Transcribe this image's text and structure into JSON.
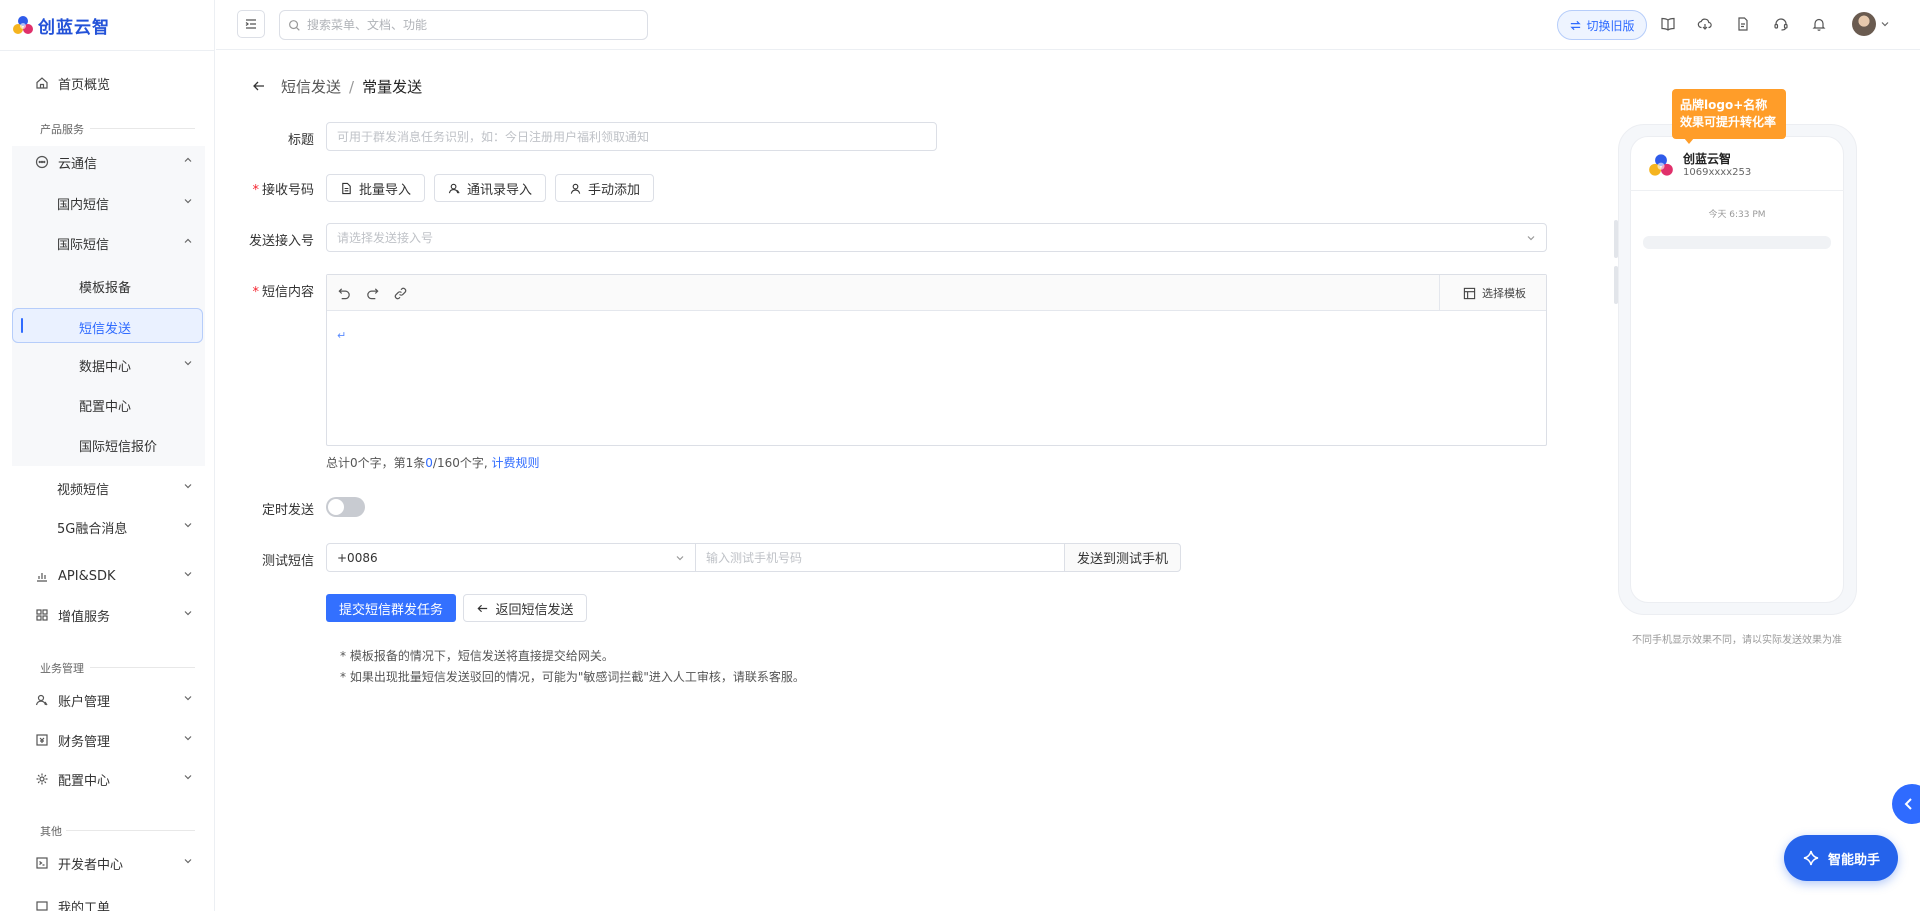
{
  "brand": {
    "name": "创蓝云智"
  },
  "search": {
    "placeholder": "搜索菜单、文档、功能"
  },
  "topbar": {
    "switch_label": "切换旧版"
  },
  "sidebar": {
    "home": "首页概览",
    "group_product": "产品服务",
    "cloud_comm": "云通信",
    "domestic_sms": "国内短信",
    "intl_sms": "国际短信",
    "template_filing": "模板报备",
    "sms_send": "短信发送",
    "data_center": "数据中心",
    "config_center_sub": "配置中心",
    "intl_price": "国际短信报价",
    "video_sms": "视频短信",
    "msg_5g": "5G融合消息",
    "api_sdk": "API&SDK",
    "value_added": "增值服务",
    "group_business": "业务管理",
    "account_mgmt": "账户管理",
    "finance_mgmt": "财务管理",
    "config_center": "配置中心",
    "group_other": "其他",
    "dev_center": "开发者中心",
    "cut_item": "我的工单"
  },
  "breadcrumb": {
    "parent": "短信发送",
    "sep": "/",
    "current": "常量发送"
  },
  "form": {
    "title_label": "标题",
    "title_placeholder": "可用于群发消息任务识别，如：今日注册用户福利领取通知",
    "receiver_label": "接收号码",
    "batch_import": "批量导入",
    "contacts_import": "通讯录导入",
    "manual_add": "手动添加",
    "access_label": "发送接入号",
    "access_placeholder": "请选择发送接入号",
    "content_label": "短信内容",
    "choose_template": "选择模板",
    "counter_prefix": "总计0个字，第1条",
    "counter_num": "0",
    "counter_suffix": "/160个字,",
    "billing_rule": "计费规则",
    "schedule_label": "定时发送",
    "test_label": "测试短信",
    "country_code": "+0086",
    "test_placeholder": "输入测试手机号码",
    "send_test": "发送到测试手机",
    "submit": "提交短信群发任务",
    "back_send": "返回短信发送",
    "note1": "* 模板报备的情况下，短信发送将直接提交给网关。",
    "note2": "* 如果出现批量短信发送驳回的情况，可能为\"敏感词拦截\"进入人工审核，请联系客服。"
  },
  "preview": {
    "tip_line1": "品牌logo+名称",
    "tip_line2": "效果可提升转化率",
    "sender_name": "创蓝云智",
    "sender_number": "1069xxxx253",
    "time": "今天 6:33 PM",
    "note": "不同手机显示效果不同，请以实际发送效果为准"
  },
  "assistant": {
    "label": "智能助手"
  },
  "colors": {
    "primary": "#3370ff",
    "tip": "#ff9d29",
    "brand": "#2352d8"
  }
}
